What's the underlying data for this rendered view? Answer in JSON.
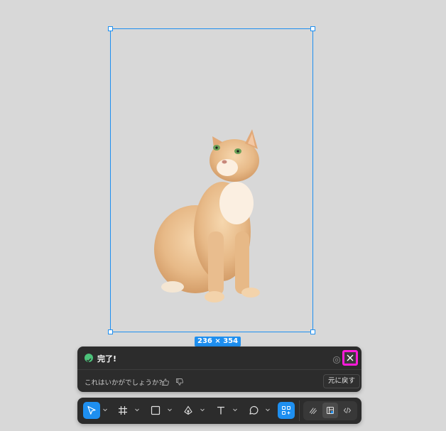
{
  "canvas": {
    "frame_size_label": "236 × 354"
  },
  "notification": {
    "status_text": "完了!",
    "feedback_prompt": "これはいかがでしょうか?",
    "undo_label": "元に戻す"
  },
  "toolbar": {
    "tools": [
      {
        "name": "move",
        "icon": "pointer-icon",
        "active": true
      },
      {
        "name": "frame",
        "icon": "hash-frame-icon",
        "active": false
      },
      {
        "name": "shape",
        "icon": "rectangle-icon",
        "active": false
      },
      {
        "name": "pen",
        "icon": "pen-icon",
        "active": false
      },
      {
        "name": "text",
        "icon": "text-icon",
        "active": false
      },
      {
        "name": "comment",
        "icon": "comment-icon",
        "active": false
      },
      {
        "name": "actions",
        "icon": "actions-grid-icon",
        "active": true
      }
    ],
    "modes": [
      {
        "name": "draw",
        "icon": "draw-mode-icon",
        "active": false
      },
      {
        "name": "design",
        "icon": "design-mode-icon",
        "active": true
      },
      {
        "name": "dev",
        "icon": "code-icon",
        "active": false
      }
    ]
  },
  "colors": {
    "selection": "#1e8ff0",
    "panel_bg": "#2c2c2c",
    "success": "#4cc27a",
    "highlight": "#ff1ad9"
  }
}
